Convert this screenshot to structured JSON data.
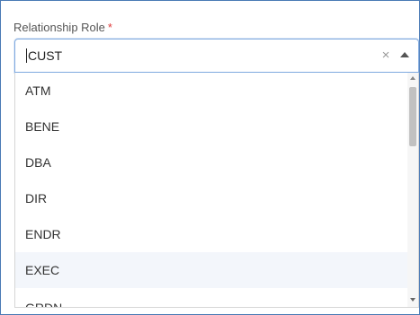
{
  "field": {
    "label": "Relationship Role",
    "required_mark": "*",
    "value": "CUST",
    "clear_symbol": "×"
  },
  "dropdown": {
    "options": [
      "ATM",
      "BENE",
      "DBA",
      "DIR",
      "ENDR",
      "EXEC",
      "GRDN"
    ],
    "highlighted_index": 5
  },
  "icons": {
    "clear": "close-icon",
    "open_caret": "chevron-up-icon",
    "scroll_up": "scroll-up-arrow-icon",
    "scroll_down": "scroll-down-arrow-icon"
  },
  "colors": {
    "frame_border": "#4a7ab5",
    "focus_border": "#7ea9df",
    "required": "#e03b3b",
    "highlight_row": "#f3f6fb"
  }
}
